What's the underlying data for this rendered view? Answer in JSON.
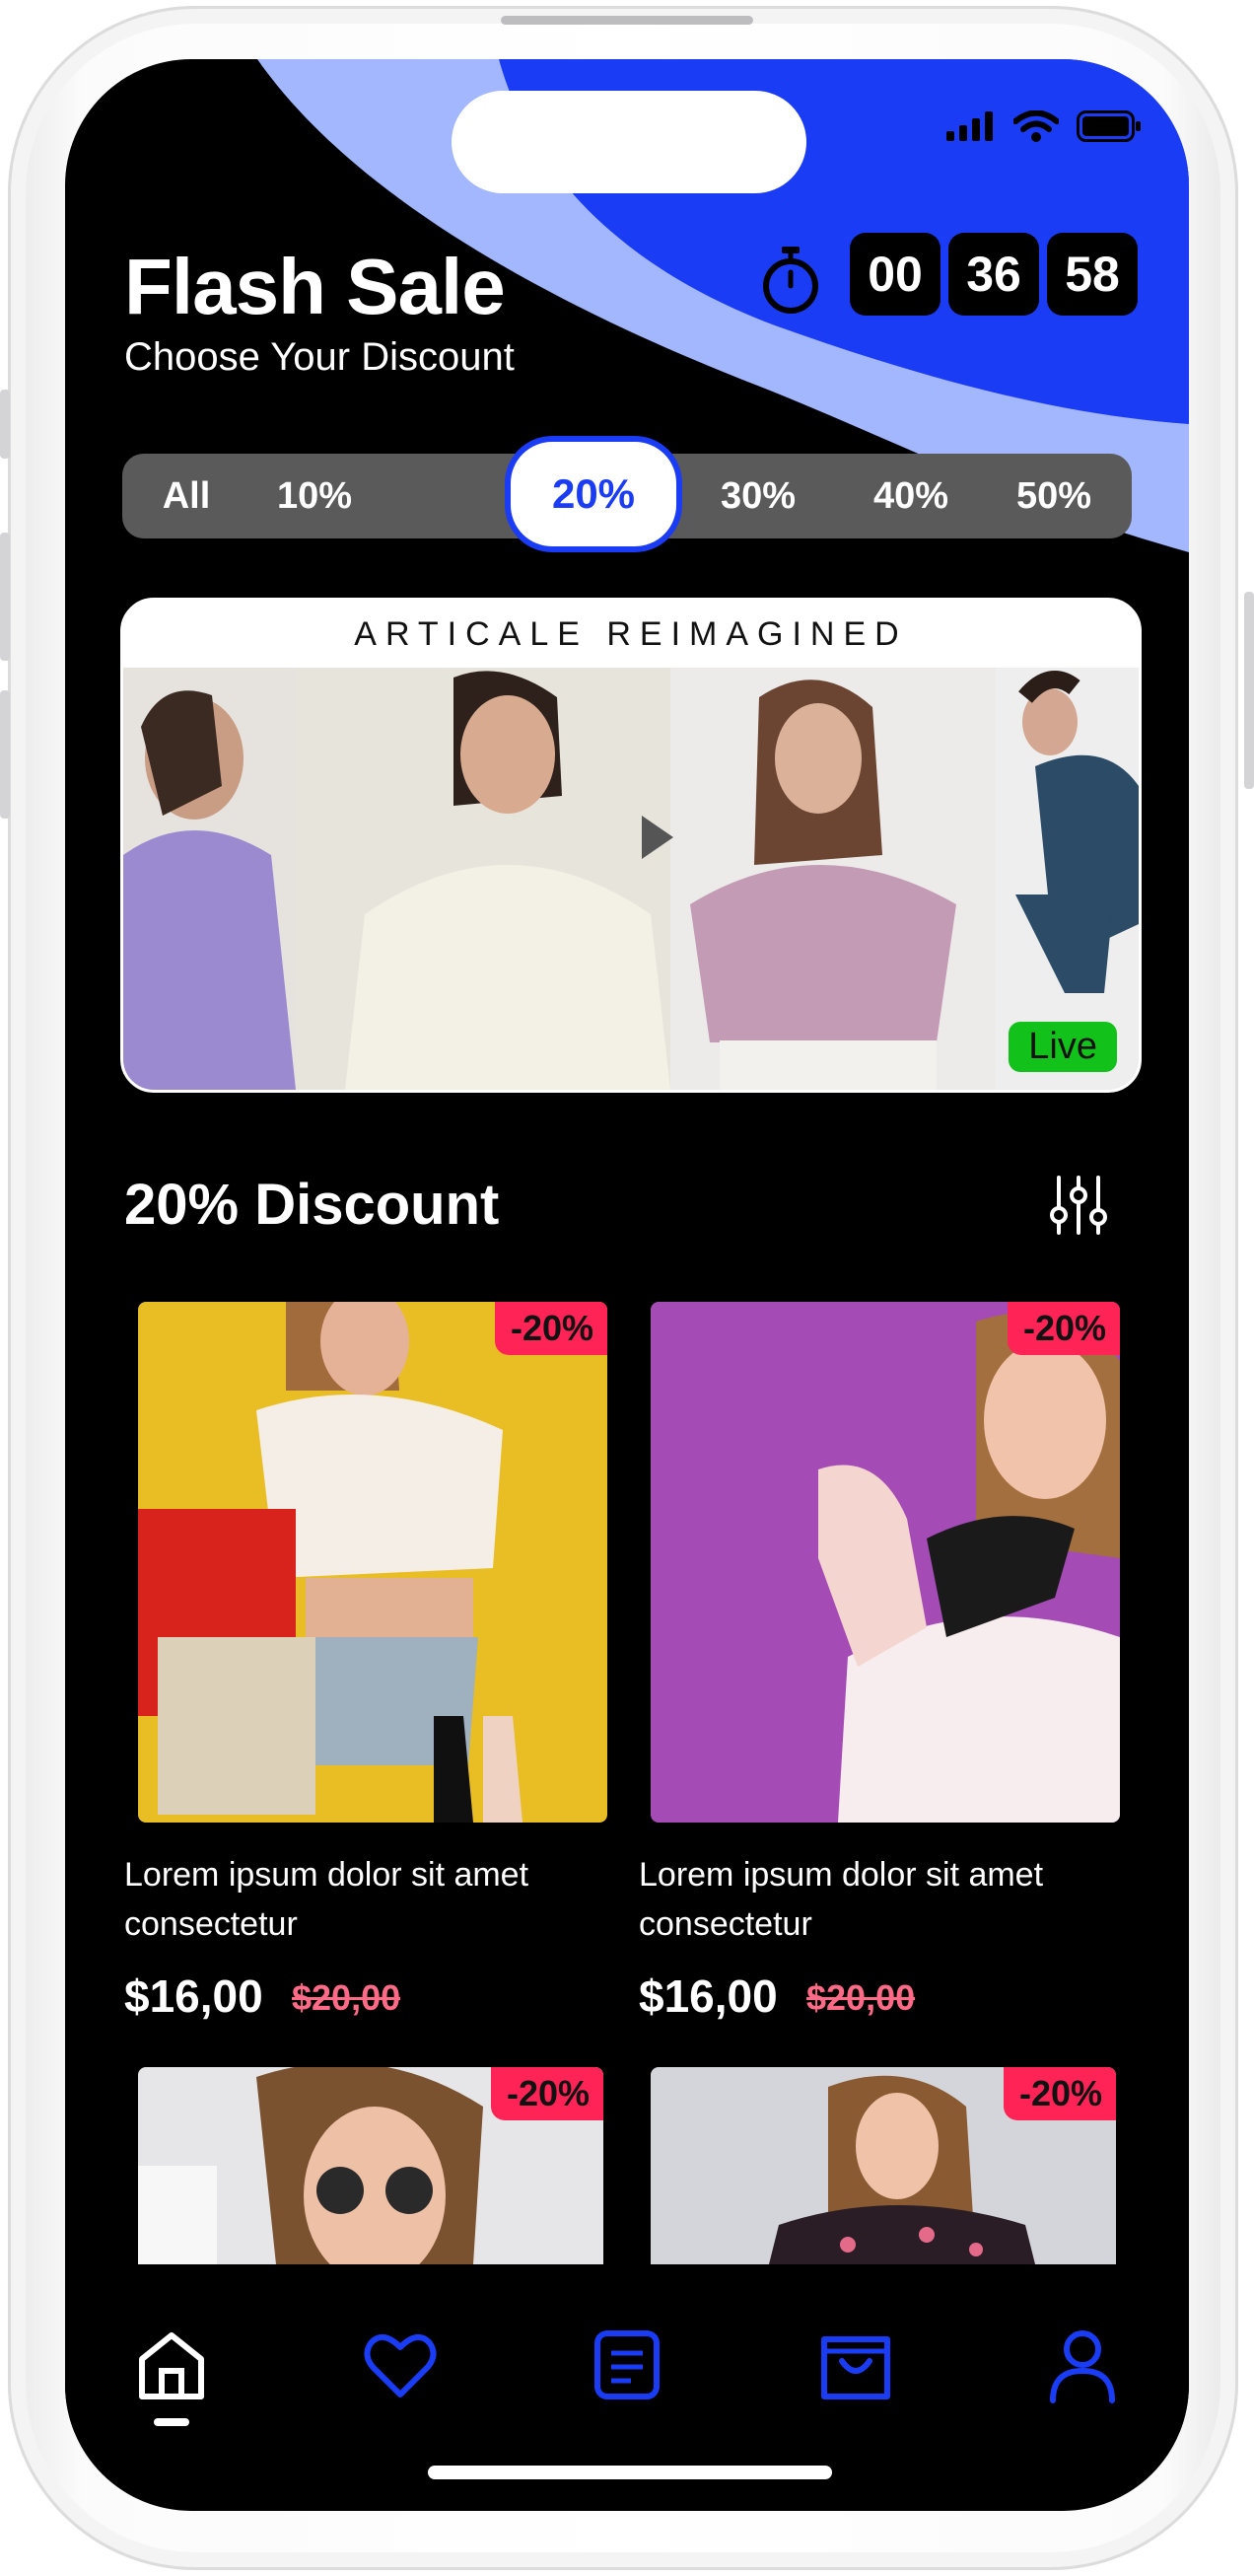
{
  "header": {
    "title": "Flash Sale",
    "subtitle": "Choose Your Discount",
    "timer": [
      "00",
      "36",
      "58"
    ]
  },
  "filters": {
    "items": [
      "All",
      "10%",
      "20%",
      "30%",
      "40%",
      "50%"
    ],
    "active": "20%"
  },
  "banner": {
    "title": "ARTICALE REIMAGINED",
    "live_label": "Live"
  },
  "section": {
    "title": "20% Discount"
  },
  "products": [
    {
      "badge": "-20%",
      "description": "Lorem ipsum dolor sit amet consectetur",
      "price": "$16,00",
      "old_price": "$20,00"
    },
    {
      "badge": "-20%",
      "description": "Lorem ipsum dolor sit amet consectetur",
      "price": "$16,00",
      "old_price": "$20,00"
    },
    {
      "badge": "-20%"
    },
    {
      "badge": "-20%"
    }
  ],
  "nav": {
    "items": [
      "home-icon",
      "heart-icon",
      "orders-icon",
      "bag-icon",
      "profile-icon"
    ],
    "active": "home-icon"
  },
  "colors": {
    "accent": "#1b3cf5",
    "accent_light": "#a3b7ff",
    "badge": "#ff2356",
    "live": "#12c21a",
    "old_price": "#ff6a86"
  }
}
